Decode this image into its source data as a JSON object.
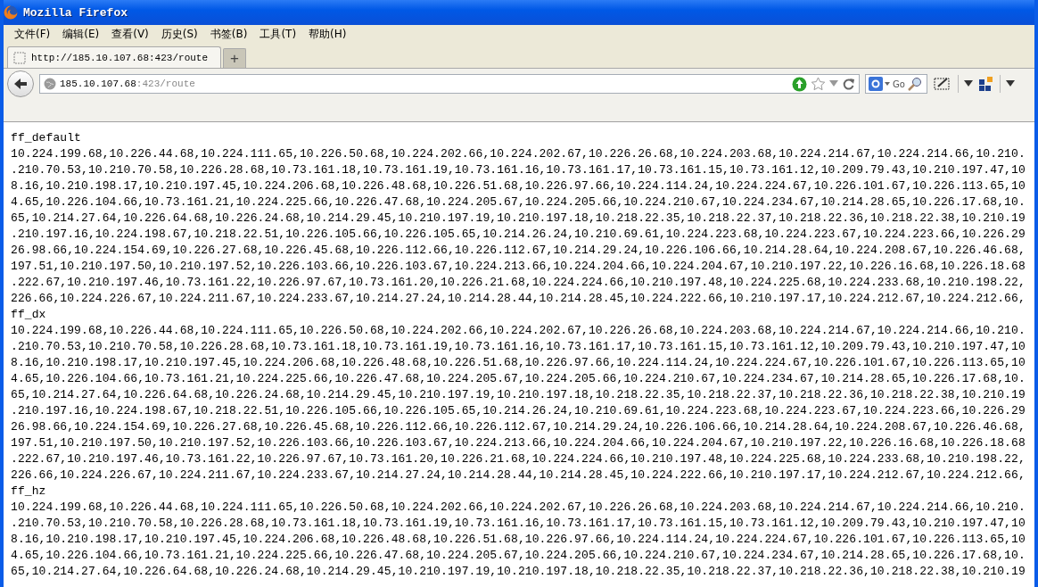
{
  "window": {
    "title": "Mozilla Firefox"
  },
  "menu": [
    {
      "label": "文件(F)"
    },
    {
      "label": "编辑(E)"
    },
    {
      "label": "查看(V)"
    },
    {
      "label": "历史(S)"
    },
    {
      "label": "书签(B)"
    },
    {
      "label": "工具(T)"
    },
    {
      "label": "帮助(H)"
    }
  ],
  "tabs": [
    {
      "label": "http://185.10.107.68:423/route",
      "selected": true
    }
  ],
  "new_tab": "+",
  "address": {
    "host": "185.10.107.68",
    "path": ":423/route"
  },
  "search": {
    "go": "Go"
  },
  "sections": [
    {
      "heading": "ff_default",
      "lines": [
        "10.224.199.68,10.226.44.68,10.224.111.65,10.226.50.68,10.224.202.66,10.224.202.67,10.226.26.68,10.224.203.68,10.224.214.67,10.224.214.66,10.210.",
        ".210.70.53,10.210.70.58,10.226.28.68,10.73.161.18,10.73.161.19,10.73.161.16,10.73.161.17,10.73.161.15,10.73.161.12,10.209.79.43,10.210.197.47,10",
        "8.16,10.210.198.17,10.210.197.45,10.224.206.68,10.226.48.68,10.226.51.68,10.226.97.66,10.224.114.24,10.224.224.67,10.226.101.67,10.226.113.65,10",
        "4.65,10.226.104.66,10.73.161.21,10.224.225.66,10.226.47.68,10.224.205.67,10.224.205.66,10.224.210.67,10.224.234.67,10.214.28.65,10.226.17.68,10.",
        "65,10.214.27.64,10.226.64.68,10.226.24.68,10.214.29.45,10.210.197.19,10.210.197.18,10.218.22.35,10.218.22.37,10.218.22.36,10.218.22.38,10.210.19",
        ".210.197.16,10.224.198.67,10.218.22.51,10.226.105.66,10.226.105.65,10.214.26.24,10.210.69.61,10.224.223.68,10.224.223.67,10.224.223.66,10.226.29",
        "26.98.66,10.224.154.69,10.226.27.68,10.226.45.68,10.226.112.66,10.226.112.67,10.214.29.24,10.226.106.66,10.214.28.64,10.224.208.67,10.226.46.68,",
        "197.51,10.210.197.50,10.210.197.52,10.226.103.66,10.226.103.67,10.224.213.66,10.224.204.66,10.224.204.67,10.210.197.22,10.226.16.68,10.226.18.68",
        ".222.67,10.210.197.46,10.73.161.22,10.226.97.67,10.73.161.20,10.226.21.68,10.224.224.66,10.210.197.48,10.224.225.68,10.224.233.68,10.210.198.22,",
        "226.66,10.224.226.67,10.224.211.67,10.224.233.67,10.214.27.24,10.214.28.44,10.214.28.45,10.224.222.66,10.210.197.17,10.224.212.67,10.224.212.66,"
      ]
    },
    {
      "heading": "ff_dx",
      "lines": [
        "10.224.199.68,10.226.44.68,10.224.111.65,10.226.50.68,10.224.202.66,10.224.202.67,10.226.26.68,10.224.203.68,10.224.214.67,10.224.214.66,10.210.",
        ".210.70.53,10.210.70.58,10.226.28.68,10.73.161.18,10.73.161.19,10.73.161.16,10.73.161.17,10.73.161.15,10.73.161.12,10.209.79.43,10.210.197.47,10",
        "8.16,10.210.198.17,10.210.197.45,10.224.206.68,10.226.48.68,10.226.51.68,10.226.97.66,10.224.114.24,10.224.224.67,10.226.101.67,10.226.113.65,10",
        "4.65,10.226.104.66,10.73.161.21,10.224.225.66,10.226.47.68,10.224.205.67,10.224.205.66,10.224.210.67,10.224.234.67,10.214.28.65,10.226.17.68,10.",
        "65,10.214.27.64,10.226.64.68,10.226.24.68,10.214.29.45,10.210.197.19,10.210.197.18,10.218.22.35,10.218.22.37,10.218.22.36,10.218.22.38,10.210.19",
        ".210.197.16,10.224.198.67,10.218.22.51,10.226.105.66,10.226.105.65,10.214.26.24,10.210.69.61,10.224.223.68,10.224.223.67,10.224.223.66,10.226.29",
        "26.98.66,10.224.154.69,10.226.27.68,10.226.45.68,10.226.112.66,10.226.112.67,10.214.29.24,10.226.106.66,10.214.28.64,10.224.208.67,10.226.46.68,",
        "197.51,10.210.197.50,10.210.197.52,10.226.103.66,10.226.103.67,10.224.213.66,10.224.204.66,10.224.204.67,10.210.197.22,10.226.16.68,10.226.18.68",
        ".222.67,10.210.197.46,10.73.161.22,10.226.97.67,10.73.161.20,10.226.21.68,10.224.224.66,10.210.197.48,10.224.225.68,10.224.233.68,10.210.198.22,",
        "226.66,10.224.226.67,10.224.211.67,10.224.233.67,10.214.27.24,10.214.28.44,10.214.28.45,10.224.222.66,10.210.197.17,10.224.212.67,10.224.212.66,"
      ]
    },
    {
      "heading": "ff_hz",
      "lines": [
        "10.224.199.68,10.226.44.68,10.224.111.65,10.226.50.68,10.224.202.66,10.224.202.67,10.226.26.68,10.224.203.68,10.224.214.67,10.224.214.66,10.210.",
        ".210.70.53,10.210.70.58,10.226.28.68,10.73.161.18,10.73.161.19,10.73.161.16,10.73.161.17,10.73.161.15,10.73.161.12,10.209.79.43,10.210.197.47,10",
        "8.16,10.210.198.17,10.210.197.45,10.224.206.68,10.226.48.68,10.226.51.68,10.226.97.66,10.224.114.24,10.224.224.67,10.226.101.67,10.226.113.65,10",
        "4.65,10.226.104.66,10.73.161.21,10.224.225.66,10.226.47.68,10.224.205.67,10.224.205.66,10.224.210.67,10.224.234.67,10.214.28.65,10.226.17.68,10.",
        "65,10.214.27.64,10.226.64.68,10.226.24.68,10.214.29.45,10.210.197.19,10.210.197.18,10.218.22.35,10.218.22.37,10.218.22.36,10.218.22.38,10.210.19"
      ]
    }
  ]
}
